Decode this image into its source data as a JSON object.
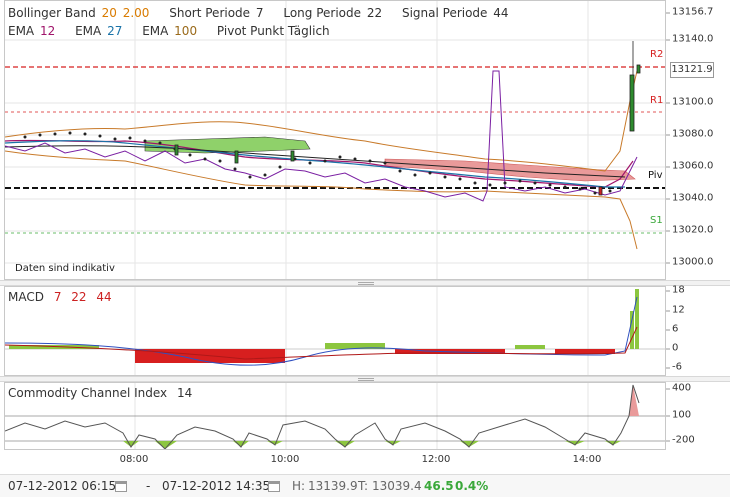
{
  "legend_top": {
    "row1": [
      {
        "label": "Bollinger Band",
        "v1": "20",
        "v2": "2.00"
      },
      {
        "label": "Short Periode",
        "v1": "7"
      },
      {
        "label": "Long Periode",
        "v1": "22"
      },
      {
        "label": "Signal Periode",
        "v1": "44"
      }
    ],
    "row2": [
      {
        "label": "EMA",
        "v1": "12"
      },
      {
        "label": "EMA",
        "v1": "27"
      },
      {
        "label": "EMA",
        "v1": "100"
      },
      {
        "label": "Pivot Punkt Täglich"
      }
    ]
  },
  "price_axis": [
    "13156.7",
    "13140.0",
    "13100.0",
    "13080.0",
    "13060.0",
    "13040.0",
    "13020.0",
    "13000.0"
  ],
  "pivot_labels": {
    "r2": "R2",
    "r1": "R1",
    "piv": "Piv",
    "s1": "S1"
  },
  "current_price_badge": "13121.9",
  "note": "Daten sind indikativ",
  "macd": {
    "label": "MACD",
    "p1": "7",
    "p2": "22",
    "p3": "44",
    "axis": [
      "18",
      "12",
      "6",
      "0",
      "-6"
    ]
  },
  "cci": {
    "label": "Commodity Channel Index",
    "period": "14",
    "axis": [
      "400",
      "100",
      "-200"
    ]
  },
  "time_axis": [
    "08:00",
    "10:00",
    "12:00",
    "14:00"
  ],
  "footer": {
    "from": "07-12-2012 06:15",
    "sep": "-",
    "to": "07-12-2012 14:35",
    "high_label": "H:",
    "high": "13139.9",
    "low_label": "T:",
    "low": "13039.4",
    "change": "46.5",
    "change_pct": "0.4%"
  },
  "colors": {
    "up": "#2e8b2e",
    "down": "#cc2222",
    "pivot_red": "#d62020",
    "pivot_green": "#3aa83a",
    "green_hist": "#8cc63f",
    "red_hist": "#d71f1f"
  }
}
